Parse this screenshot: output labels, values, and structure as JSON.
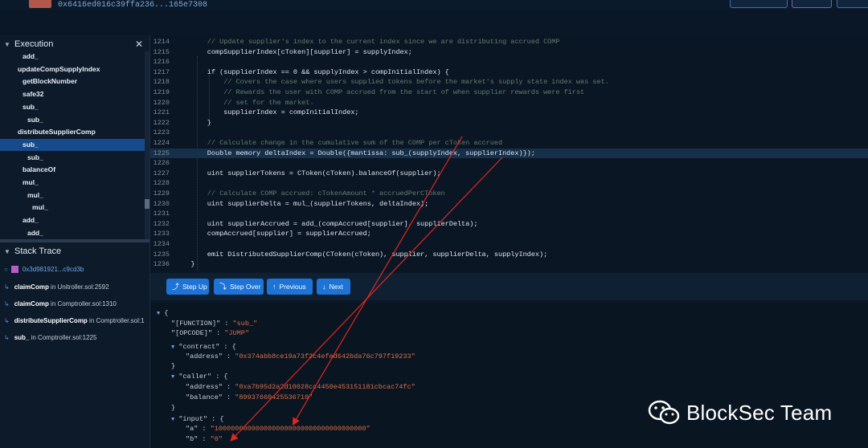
{
  "header": {
    "address": "0x6416ed016c39ffa236...165e7308"
  },
  "execution": {
    "title": "Execution",
    "items": [
      {
        "label": "add_",
        "indent": 2,
        "selected": false
      },
      {
        "label": "updateCompSupplyIndex",
        "indent": 1,
        "selected": false
      },
      {
        "label": "getBlockNumber",
        "indent": 2,
        "selected": false
      },
      {
        "label": "safe32",
        "indent": 2,
        "selected": false
      },
      {
        "label": "sub_",
        "indent": 2,
        "selected": false
      },
      {
        "label": "sub_",
        "indent": 3,
        "selected": false
      },
      {
        "label": "distributeSupplierComp",
        "indent": 1,
        "selected": false
      },
      {
        "label": "sub_",
        "indent": 2,
        "selected": true
      },
      {
        "label": "sub_",
        "indent": 3,
        "selected": false
      },
      {
        "label": "balanceOf",
        "indent": 2,
        "selected": false
      },
      {
        "label": "mul_",
        "indent": 2,
        "selected": false
      },
      {
        "label": "mul_",
        "indent": 3,
        "selected": false
      },
      {
        "label": "mul_",
        "indent": 4,
        "selected": false
      },
      {
        "label": "add_",
        "indent": 2,
        "selected": false
      },
      {
        "label": "add_",
        "indent": 3,
        "selected": false
      }
    ]
  },
  "stack_trace": {
    "title": "Stack Trace",
    "root": "0x3d981921...c9cd3b",
    "frames": [
      {
        "fn": "claimComp",
        "sep": " in ",
        "loc": "Unitroller.sol:2592"
      },
      {
        "fn": "claimComp",
        "sep": " in ",
        "loc": "Comptroller.sol:1310"
      },
      {
        "fn": "distributeSupplierComp",
        "sep": " in ",
        "loc": "Comptroller.sol:1"
      },
      {
        "fn": "sub_",
        "sep": " in ",
        "loc": "Comptroller.sol:1225"
      }
    ]
  },
  "code": {
    "highlight_line": "1225",
    "lines": [
      {
        "n": "1214",
        "t": "        // Update supplier's index to the current index since we are distributing accrued COMP",
        "c": true
      },
      {
        "n": "1215",
        "t": "        compSupplierIndex[cToken][supplier] = supplyIndex;",
        "c": false
      },
      {
        "n": "1216",
        "t": "",
        "c": false
      },
      {
        "n": "1217",
        "t": "        if (supplierIndex == 0 && supplyIndex > compInitialIndex) {",
        "c": false
      },
      {
        "n": "1218",
        "t": "            // Covers the case where users supplied tokens before the market's supply state index was set.",
        "c": true
      },
      {
        "n": "1219",
        "t": "            // Rewards the user with COMP accrued from the start of when supplier rewards were first",
        "c": true
      },
      {
        "n": "1220",
        "t": "            // set for the market.",
        "c": true
      },
      {
        "n": "1221",
        "t": "            supplierIndex = compInitialIndex;",
        "c": false
      },
      {
        "n": "1222",
        "t": "        }",
        "c": false
      },
      {
        "n": "1223",
        "t": "",
        "c": false
      },
      {
        "n": "1224",
        "t": "        // Calculate change in the cumulative sum of the COMP per cToken accrued",
        "c": true
      },
      {
        "n": "1225",
        "t": "        Double memory deltaIndex = Double({mantissa: sub_(supplyIndex, supplierIndex)});",
        "c": false
      },
      {
        "n": "1226",
        "t": "",
        "c": false
      },
      {
        "n": "1227",
        "t": "        uint supplierTokens = CToken(cToken).balanceOf(supplier);",
        "c": false
      },
      {
        "n": "1228",
        "t": "",
        "c": false
      },
      {
        "n": "1229",
        "t": "        // Calculate COMP accrued: cTokenAmount * accruedPerCToken",
        "c": true
      },
      {
        "n": "1230",
        "t": "        uint supplierDelta = mul_(supplierTokens, deltaIndex);",
        "c": false
      },
      {
        "n": "1231",
        "t": "",
        "c": false
      },
      {
        "n": "1232",
        "t": "        uint supplierAccrued = add_(compAccrued[supplier], supplierDelta);",
        "c": false
      },
      {
        "n": "1233",
        "t": "        compAccrued[supplier] = supplierAccrued;",
        "c": false
      },
      {
        "n": "1234",
        "t": "",
        "c": false
      },
      {
        "n": "1235",
        "t": "        emit DistributedSupplierComp(CToken(cToken), supplier, supplierDelta, supplyIndex);",
        "c": false
      },
      {
        "n": "1236",
        "t": "    }",
        "c": false
      }
    ]
  },
  "controls": {
    "step_up": "Step Up",
    "step_over": "Step Over",
    "previous": "Previous",
    "next": "Next"
  },
  "json_view": {
    "open_brace": "{",
    "function_key": "\"[FUNCTION]\"",
    "function_val": "\"sub_\"",
    "opcode_key": "\"[OPCODE]\"",
    "opcode_val": "\"JUMP\"",
    "contract_key": "\"contract\"",
    "contract_address_key": "\"address\"",
    "contract_address_val": "\"0x374abb8ce19a73f2c4efad642bda76c797f19233\"",
    "caller_key": "\"caller\"",
    "caller_address_key": "\"address\"",
    "caller_address_val": "\"0xa7b95d2a2d10028cc4450e453151181cbcac74fc\"",
    "caller_balance_key": "\"balance\"",
    "caller_balance_val": "\"89937660425536710\"",
    "input_key": "\"input\"",
    "input_a_key": "\"a\"",
    "input_a_val": "\"1000000000000000000000000000000000000\"",
    "input_b_key": "\"b\"",
    "input_b_val": "\"0\""
  },
  "watermark": {
    "text": "BlockSec Team"
  },
  "colors": {
    "accent": "#1d73d6",
    "selected": "#174a8a",
    "annotation_arrow": "#e0271e",
    "json_string": "#d96d45"
  }
}
